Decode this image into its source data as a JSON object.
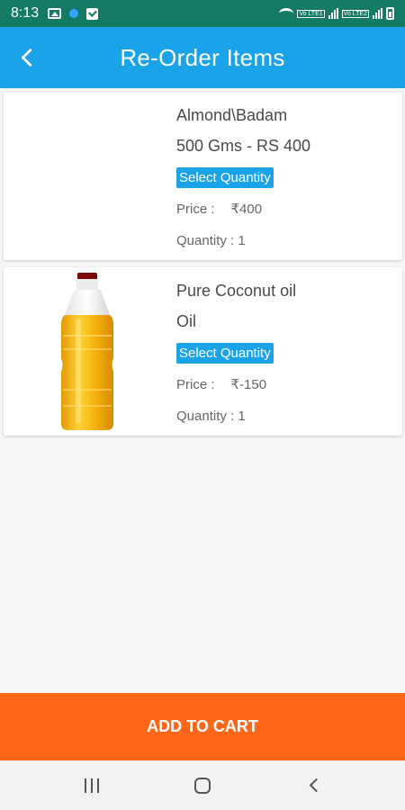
{
  "status_bar": {
    "time": "8:13"
  },
  "header": {
    "title": "Re-Order Items"
  },
  "items": [
    {
      "name": "Almond\\Badam",
      "variant": "500 Gms - RS 400",
      "select_label": "Select Quantity",
      "price_label": "Price :",
      "price_value": "₹400",
      "quantity_text": "Quantity : 1"
    },
    {
      "name": "Pure Coconut oil",
      "variant": "Oil",
      "select_label": "Select Quantity",
      "price_label": "Price :",
      "price_value": "₹-150",
      "quantity_text": "Quantity : 1"
    }
  ],
  "footer": {
    "add_to_cart": "ADD TO CART"
  },
  "colors": {
    "status_bar": "#157a63",
    "app_bar": "#1aa3e8",
    "accent_button": "#fe6618"
  }
}
